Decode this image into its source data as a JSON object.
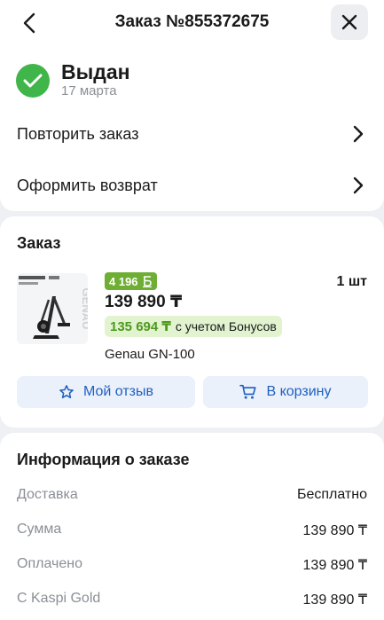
{
  "header": {
    "title": "Заказ №855372675"
  },
  "status": {
    "title": "Выдан",
    "date": "17 марта",
    "color": "#3fb54a"
  },
  "actions": [
    {
      "label": "Повторить заказ"
    },
    {
      "label": "Оформить возврат"
    }
  ],
  "order": {
    "section_title": "Заказ",
    "bonus_badge": "4 196",
    "bonus_currency_icon": "bonus-b-icon",
    "price": "139 890 ₸",
    "quantity": "1 шт",
    "bonus_price": "135 694 ₸",
    "bonus_note": "с учетом Бонусов",
    "product_name": "Genau GN-100",
    "image_brand": "GENAU",
    "review_button": "Мой отзыв",
    "cart_button": "В корзину",
    "accent_color": "#1f5fbf"
  },
  "info": {
    "section_title": "Информация о заказе",
    "rows": [
      {
        "label": "Доставка",
        "value": "Бесплатно"
      },
      {
        "label": "Сумма",
        "value": "139 890 ₸"
      },
      {
        "label": "Оплачено",
        "value": "139 890 ₸"
      },
      {
        "label": "С Kaspi Gold",
        "value": "139 890 ₸"
      }
    ]
  }
}
